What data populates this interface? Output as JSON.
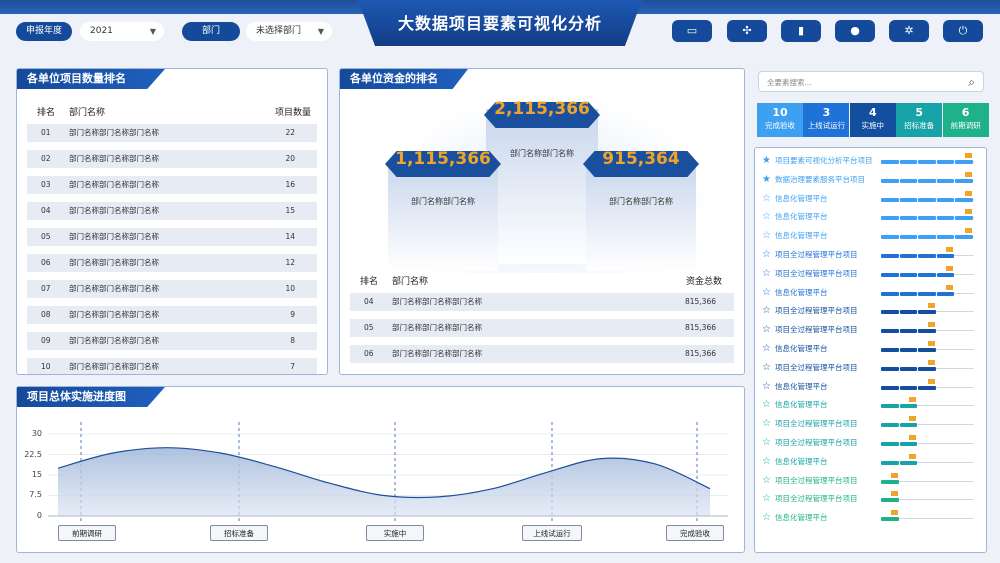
{
  "header": {
    "title": "大数据项目要素可视化分析",
    "year_label": "申报年度",
    "year_value": "2021",
    "dept_label": "部门",
    "dept_value": "未选择部门",
    "toolbar_icons": [
      "monitor-icon",
      "grid-icon",
      "bar-chart-icon",
      "user-badge-icon",
      "gear-icon",
      "power-icon"
    ]
  },
  "rank_panel": {
    "title": "各单位项目数量排名",
    "headers": [
      "排名",
      "部门名称",
      "项目数量"
    ],
    "rows": [
      [
        "01",
        "部门名称部门名称部门名称",
        "22"
      ],
      [
        "02",
        "部门名称部门名称部门名称",
        "20"
      ],
      [
        "03",
        "部门名称部门名称部门名称",
        "16"
      ],
      [
        "04",
        "部门名称部门名称部门名称",
        "15"
      ],
      [
        "05",
        "部门名称部门名称部门名称",
        "14"
      ],
      [
        "06",
        "部门名称部门名称部门名称",
        "12"
      ],
      [
        "07",
        "部门名称部门名称部门名称",
        "10"
      ],
      [
        "08",
        "部门名称部门名称部门名称",
        "9"
      ],
      [
        "09",
        "部门名称部门名称部门名称",
        "8"
      ],
      [
        "10",
        "部门名称部门名称部门名称",
        "7"
      ]
    ]
  },
  "funds_panel": {
    "title": "各单位资金的排名",
    "podium": [
      {
        "value": "2,115,366",
        "name": "部门名称部门名称"
      },
      {
        "value": "1,115,366",
        "name": "部门名称部门名称"
      },
      {
        "value": "915,364",
        "name": "部门名称部门名称"
      }
    ],
    "headers": [
      "排名",
      "部门名称",
      "资金总数"
    ],
    "rows": [
      [
        "04",
        "部门名称部门名称部门名称",
        "815,366"
      ],
      [
        "05",
        "部门名称部门名称部门名称",
        "815,366"
      ],
      [
        "06",
        "部门名称部门名称部门名称",
        "815,366"
      ]
    ]
  },
  "progress_panel": {
    "title": "项目总体实施进度图",
    "stages": [
      "前期调研",
      "招标准备",
      "实施中",
      "上线试运行",
      "完成验收"
    ]
  },
  "chart_data": {
    "type": "area",
    "title": "项目总体实施进度图",
    "y_ticks": [
      "30",
      "22.5",
      "15",
      "7.5",
      "0"
    ],
    "ylim": [
      0,
      30
    ],
    "x": [
      0,
      1,
      2,
      3,
      4,
      5,
      6,
      7,
      8,
      9,
      10,
      11,
      12
    ],
    "values": [
      17.5,
      23,
      25,
      23,
      18,
      12,
      7.5,
      7,
      10,
      16,
      21,
      19,
      10
    ],
    "categories": [
      "前期调研",
      "招标准备",
      "实施中",
      "上线试运行",
      "完成验收"
    ]
  },
  "right_panel": {
    "search_placeholder": "全要素搜索...",
    "stats": [
      {
        "num": "10",
        "label": "完成验收",
        "color": "#3ea0f0"
      },
      {
        "num": "3",
        "label": "上线试运行",
        "color": "#1f72d6"
      },
      {
        "num": "4",
        "label": "实施中",
        "color": "#144f9f"
      },
      {
        "num": "5",
        "label": "招标准备",
        "color": "#17a3a8"
      },
      {
        "num": "6",
        "label": "前期调研",
        "color": "#1fb28a"
      }
    ],
    "projects": [
      {
        "name": "项目要素可视化分析平台项目",
        "star": "filled",
        "color": "#3ea0f0",
        "progress": 1.0
      },
      {
        "name": "数据治理要素服务平台项目",
        "star": "filled",
        "color": "#3ea0f0",
        "progress": 1.0
      },
      {
        "name": "信息化管理平台",
        "star": "outline",
        "color": "#3ea0f0",
        "progress": 1.0
      },
      {
        "name": "信息化管理平台",
        "star": "outline",
        "color": "#3ea0f0",
        "progress": 1.0
      },
      {
        "name": "信息化管理平台",
        "star": "outline",
        "color": "#3ea0f0",
        "progress": 1.0
      },
      {
        "name": "项目全过程管理平台项目",
        "star": "outline",
        "color": "#1f72d6",
        "progress": 0.8
      },
      {
        "name": "项目全过程管理平台项目",
        "star": "outline",
        "color": "#1f72d6",
        "progress": 0.8
      },
      {
        "name": "信息化管理平台",
        "star": "outline",
        "color": "#1f72d6",
        "progress": 0.8
      },
      {
        "name": "项目全过程管理平台项目",
        "star": "outline",
        "color": "#144f9f",
        "progress": 0.6
      },
      {
        "name": "项目全过程管理平台项目",
        "star": "outline",
        "color": "#144f9f",
        "progress": 0.6
      },
      {
        "name": "信息化管理平台",
        "star": "outline",
        "color": "#144f9f",
        "progress": 0.6
      },
      {
        "name": "项目全过程管理平台项目",
        "star": "outline",
        "color": "#144f9f",
        "progress": 0.6
      },
      {
        "name": "信息化管理平台",
        "star": "outline",
        "color": "#144f9f",
        "progress": 0.6
      },
      {
        "name": "信息化管理平台",
        "star": "outline",
        "color": "#17a3a8",
        "progress": 0.4
      },
      {
        "name": "项目全过程管理平台项目",
        "star": "outline",
        "color": "#17a3a8",
        "progress": 0.4
      },
      {
        "name": "项目全过程管理平台项目",
        "star": "outline",
        "color": "#17a3a8",
        "progress": 0.4
      },
      {
        "name": "信息化管理平台",
        "star": "outline",
        "color": "#17a3a8",
        "progress": 0.4
      },
      {
        "name": "项目全过程管理平台项目",
        "star": "outline",
        "color": "#1fb28a",
        "progress": 0.2
      },
      {
        "name": "项目全过程管理平台项目",
        "star": "outline",
        "color": "#1fb28a",
        "progress": 0.2
      },
      {
        "name": "信息化管理平台",
        "star": "outline",
        "color": "#1fb28a",
        "progress": 0.2
      }
    ]
  }
}
